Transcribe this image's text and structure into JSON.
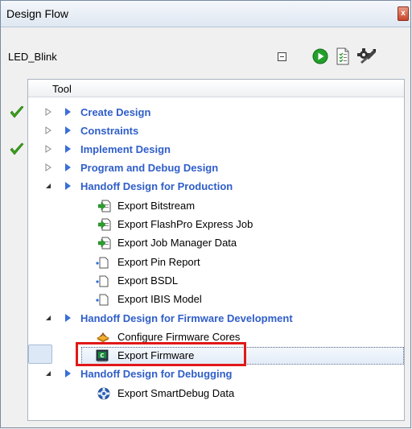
{
  "window": {
    "title": "Design Flow",
    "close_glyph": "x"
  },
  "project": {
    "name": "LED_Blink"
  },
  "toolbar": [
    "collapse-all-icon",
    "run-icon",
    "report-icon",
    "options-wrench-icon"
  ],
  "tree": {
    "column_header": "Tool",
    "groups": [
      {
        "label": "Create Design",
        "status": "complete",
        "expanded": false
      },
      {
        "label": "Constraints",
        "status": "none",
        "expanded": false
      },
      {
        "label": "Implement Design",
        "status": "complete",
        "expanded": false
      },
      {
        "label": "Program and Debug Design",
        "status": "none",
        "expanded": false
      },
      {
        "label": "Handoff Design for Production",
        "status": "none",
        "expanded": true,
        "items": [
          {
            "label": "Export Bitstream",
            "icon": "export-green-arrow-icon"
          },
          {
            "label": "Export FlashPro Express Job",
            "icon": "export-green-arrow-icon"
          },
          {
            "label": "Export Job Manager Data",
            "icon": "export-green-arrow-icon"
          },
          {
            "label": "Export Pin Report",
            "icon": "export-blank-page-icon"
          },
          {
            "label": "Export BSDL",
            "icon": "export-blank-page-icon"
          },
          {
            "label": "Export IBIS Model",
            "icon": "export-blank-page-icon"
          }
        ]
      },
      {
        "label": "Handoff Design for Firmware Development",
        "status": "none",
        "expanded": true,
        "items": [
          {
            "label": "Configure Firmware Cores",
            "icon": "firmware-cores-icon"
          },
          {
            "label": "Export Firmware",
            "icon": "export-firmware-icon",
            "selected": true
          }
        ]
      },
      {
        "label": "Handoff Design for Debugging",
        "status": "none",
        "expanded": true,
        "items": [
          {
            "label": "Export SmartDebug Data",
            "icon": "smartdebug-icon"
          }
        ]
      }
    ]
  },
  "colors": {
    "group_text": "#2f5ec9",
    "check_green": "#3aa318",
    "highlight_red": "#e01818"
  }
}
